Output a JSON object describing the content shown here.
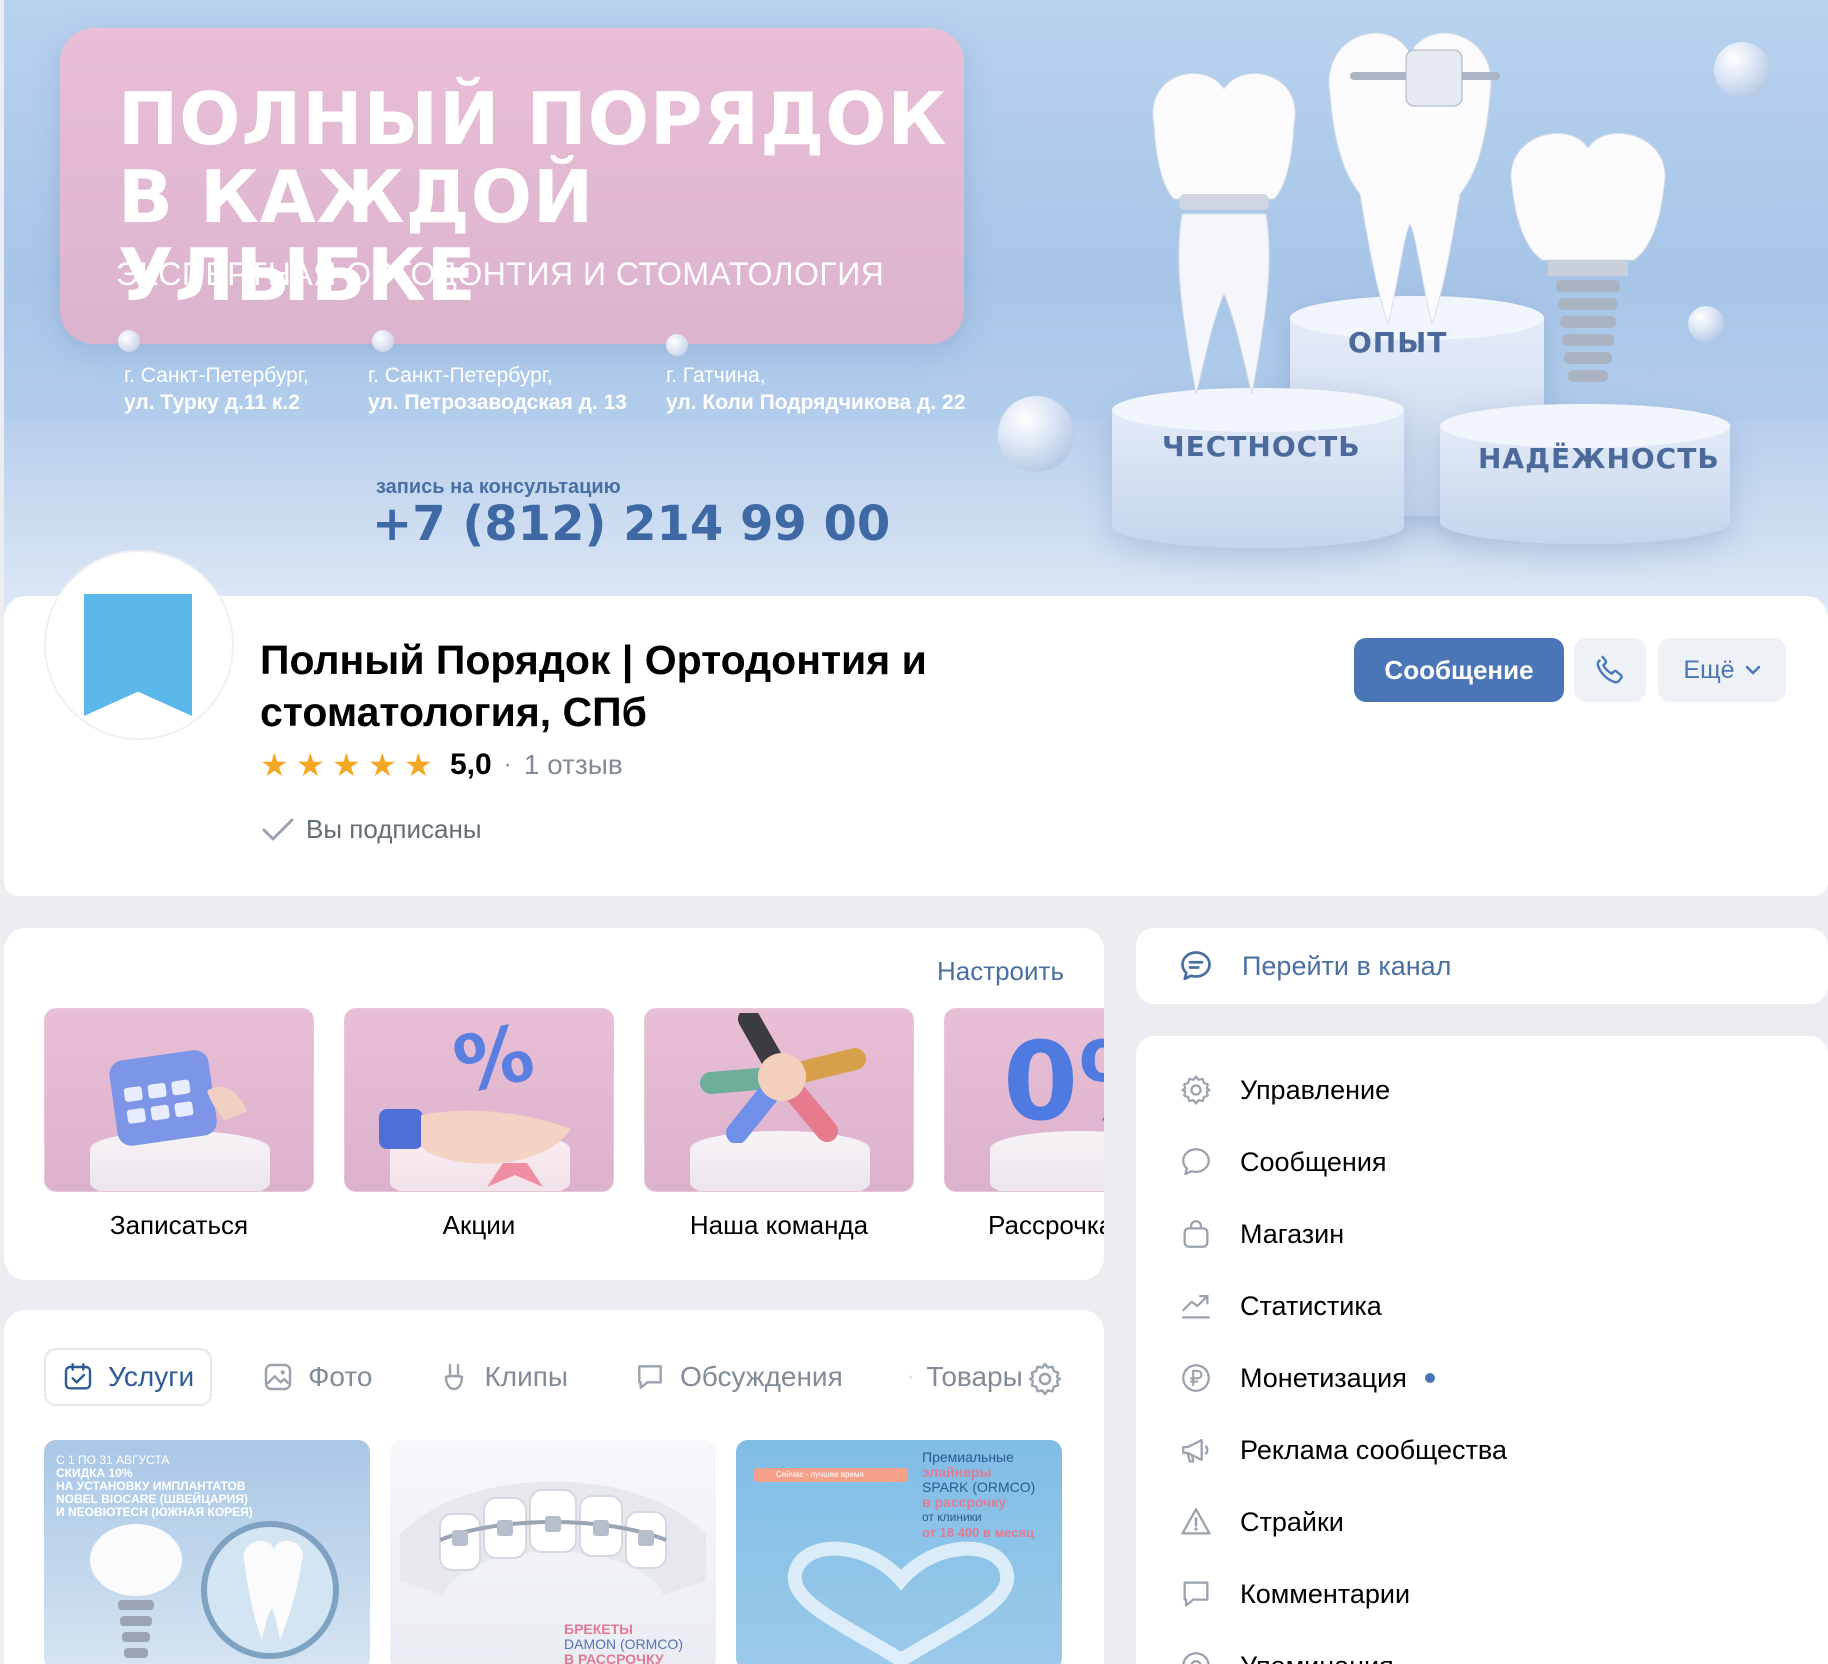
{
  "cover": {
    "title": "ПОЛНЫЙ ПОРЯДОК\nВ КАЖДОЙ УЛЫБКЕ",
    "subtitle": "ЭКСПЕРТНАЯ ОРТОДОНТИЯ И СТОМАТОЛОГИЯ",
    "addresses": [
      {
        "city": "г. Санкт-Петербург,",
        "street": "ул. Турку д.11 к.2"
      },
      {
        "city": "г. Санкт-Петербург,",
        "street": "ул. Петрозаводская д. 13"
      },
      {
        "city": "г. Гатчина,",
        "street": "ул. Коли Подрядчикова д. 22"
      }
    ],
    "phone_caption": "запись на консультацию",
    "phone": "+7 (812) 214 99 00",
    "podiums": [
      "ЧЕСТНОСТЬ",
      "ОПЫТ",
      "НАДЁЖНОСТЬ"
    ]
  },
  "profile": {
    "name": "Полный Порядок | Ортодонтия и стоматология, СПб",
    "rating_value": "5,0",
    "rating_stars": 5,
    "rating_separator": "·",
    "reviews": "1 отзыв",
    "subscribed": "Вы подписаны",
    "message_button": "Сообщение",
    "more_button": "Ещё"
  },
  "widgets": {
    "configure": "Настроить",
    "tiles": [
      "Записаться",
      "Акции",
      "Наша команда",
      "Рассрочка"
    ]
  },
  "tabs": {
    "items": [
      "Услуги",
      "Фото",
      "Клипы",
      "Обсуждения",
      "Товары"
    ],
    "active": "Услуги"
  },
  "thumbs": {
    "t1_line1": "С 1 ПО 31 АВГУСТА",
    "t1_line2": "СКИДКА 10%",
    "t1_line3": "НА УСТАНОВКУ ИМПЛАНТАТОВ",
    "t1_line4": "NOBEL BIOCARE (ШВЕЙЦАРИЯ)",
    "t1_line5": "И NEOBIOTECH (ЮЖНАЯ КОРЕЯ)",
    "t2_line1": "БРЕКЕТЫ",
    "t2_line2": "DAMON (ORMCO)",
    "t2_line3": "В РАССРОЧКУ",
    "t3_line1": "Премиальные",
    "t3_line2": "элайнеры",
    "t3_line3": "SPARK (ORMCO)",
    "t3_line4": "в рассрочку",
    "t3_line5": "от клиники",
    "t3_line6": "от 18 400 в месяц",
    "t3_tag": "Сейчас - лучшее время"
  },
  "right": {
    "channel": "Перейти в канал",
    "menu": [
      "Управление",
      "Сообщения",
      "Магазин",
      "Статистика",
      "Монетизация",
      "Реклама сообщества",
      "Страйки",
      "Комментарии",
      "Упоминания"
    ]
  },
  "colors": {
    "accent": "#4a76b8",
    "link": "#4a6fa3",
    "star": "#f5a623",
    "cover_pink": "#e8bfd6",
    "avatar_flag": "#5bb8ea"
  }
}
